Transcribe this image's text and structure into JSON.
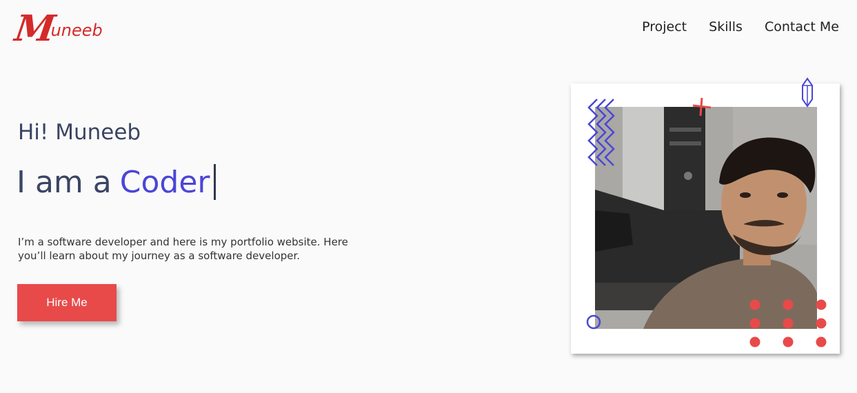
{
  "brand": {
    "logo_initial": "M",
    "logo_rest": "uneeb",
    "color": "#d42a2a"
  },
  "nav": {
    "items": [
      "Project",
      "Skills",
      "Contact Me"
    ]
  },
  "hero": {
    "greeting": "Hi! Muneeb",
    "headline_prefix": "I am a",
    "headline_role": "Coder",
    "description": "I’m a software developer and here is my portfolio website. Here you’ll learn about my journey as a software developer.",
    "cta_label": "Hire Me"
  },
  "colors": {
    "accent": "#4b46d6",
    "cta": "#e84a4a",
    "text_dark": "#3b4563"
  },
  "icons": {
    "zigzag": "zigzag-decoration-icon",
    "plus": "plus-decoration-icon",
    "crystal": "crystal-decoration-icon",
    "ring": "ring-decoration-icon",
    "dots": "dot-grid-decoration-icon"
  }
}
